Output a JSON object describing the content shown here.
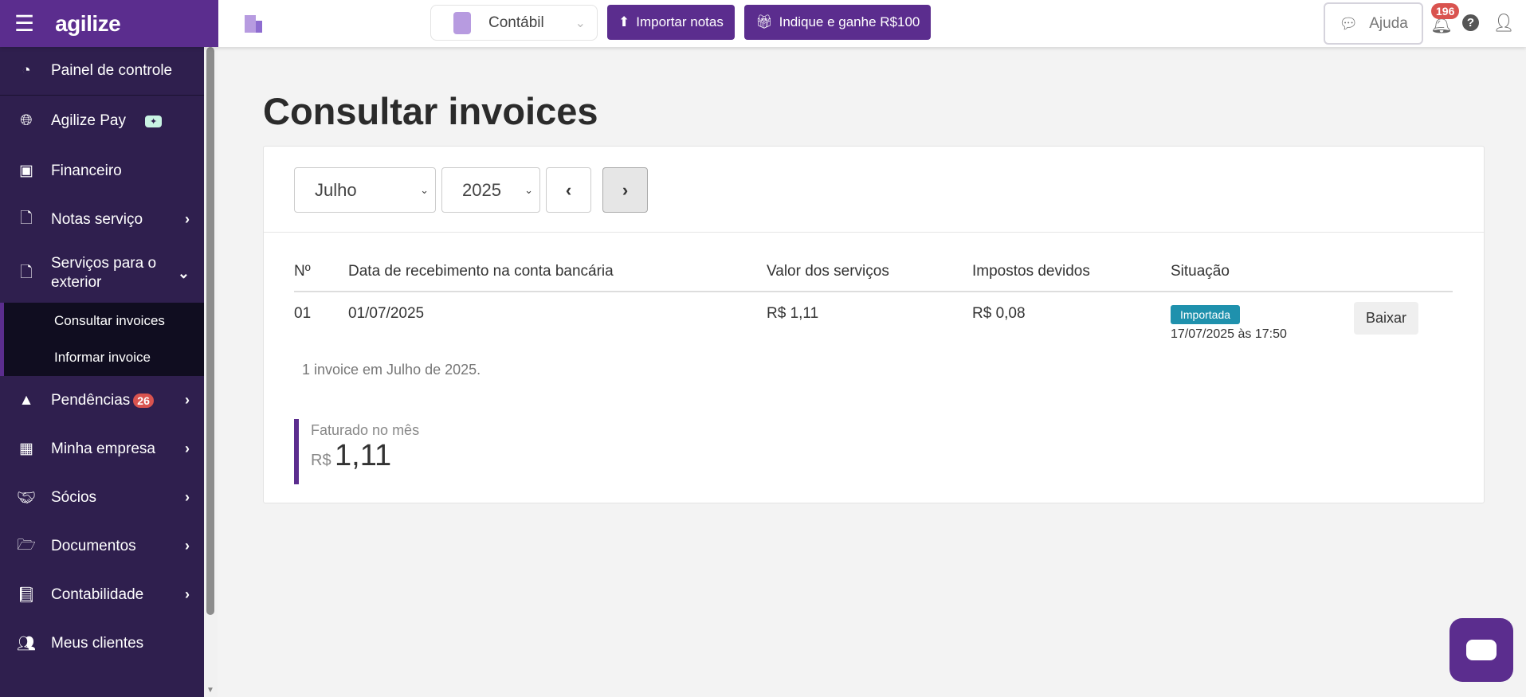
{
  "header": {
    "brand": "agilize",
    "company_select": "Contábil",
    "import_button": "Importar notas",
    "refer_button": "Indique e ganhe R$100",
    "help_button": "Ajuda",
    "notifications_count": "196"
  },
  "sidebar": {
    "items": [
      {
        "label": "Painel de controle",
        "icon": "dashboard-icon"
      },
      {
        "label": "Agilize Pay",
        "icon": "globe-dollar-icon",
        "badge": "✦"
      },
      {
        "label": "Financeiro",
        "icon": "money-icon"
      },
      {
        "label": "Notas serviço",
        "icon": "file-icon"
      },
      {
        "label": "Serviços para o exterior",
        "icon": "file-icon"
      },
      {
        "label": "Pendências",
        "icon": "warning-icon",
        "badge": "26"
      },
      {
        "label": "Minha empresa",
        "icon": "building-icon"
      },
      {
        "label": "Sócios",
        "icon": "handshake-icon"
      },
      {
        "label": "Documentos",
        "icon": "folder-icon"
      },
      {
        "label": "Contabilidade",
        "icon": "book-icon"
      },
      {
        "label": "Meus clientes",
        "icon": "users-icon"
      }
    ],
    "subitems": [
      "Consultar invoices",
      "Informar invoice"
    ]
  },
  "page": {
    "title": "Consultar invoices",
    "month": "Julho",
    "year": "2025",
    "columns": [
      "Nº",
      "Data de recebimento na conta bancária",
      "Valor dos serviços",
      "Impostos devidos",
      "Situação"
    ],
    "rows": [
      {
        "n": "01",
        "date": "01/07/2025",
        "value": "R$ 1,11",
        "taxes": "R$ 0,08",
        "status": "Importada",
        "status_date": "17/07/2025 às 17:50",
        "action": "Baixar"
      }
    ],
    "count_text": "1 invoice em Julho de 2025.",
    "billed_label": "Faturado no mês",
    "billed_currency": "R$",
    "billed_value": "1,11"
  },
  "colors": {
    "brand": "#5b2d8e",
    "sidebar": "#2f1f4e",
    "status": "#1f91ad"
  }
}
